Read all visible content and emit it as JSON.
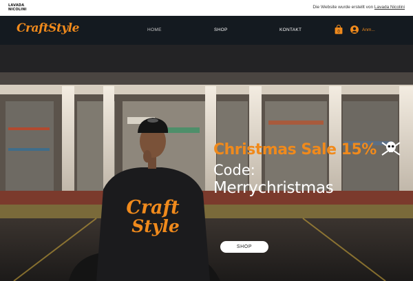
{
  "infobar": {
    "brand_line1": "LAVADA",
    "brand_line2": "NICOLINI",
    "credit_text": "Die Website wurde erstellt von ",
    "credit_link": "Lavada Nicolini"
  },
  "header": {
    "logo": "CraftStyle",
    "nav": [
      {
        "label": "HOME"
      },
      {
        "label": "SHOP"
      },
      {
        "label": "KONTAKT"
      }
    ],
    "cart_count": "0",
    "login_label": "Anm..."
  },
  "hero": {
    "sale": "Christmas Sale 15%",
    "code": "Code:",
    "promo": "Merrychristmas",
    "shop_button": "SHOP",
    "hoodie_line1": "Craft",
    "hoodie_line2": "Style"
  },
  "colors": {
    "accent": "#f08a1c",
    "header_bg": "#141a20"
  }
}
